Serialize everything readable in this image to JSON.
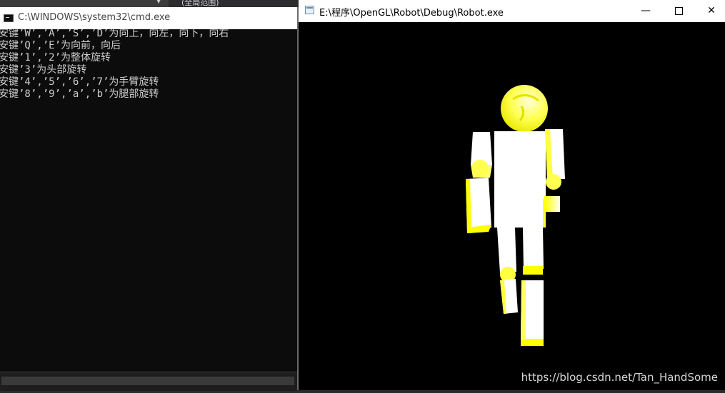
{
  "background_app": {
    "dropdown_icon": "chevron-down-icon",
    "label": "(全局范围)"
  },
  "cmd_window": {
    "title": "C:\\WINDOWS\\system32\\cmd.exe",
    "icon": "console-icon",
    "lines": [
      "安键’W’,’A’,’S’,’D’为向上，向左，向下，向右",
      "安键’Q’,’E’为向前，向后",
      "安键’1’,’2’为整体旋转",
      "安键’3’为头部旋转",
      "安键’4’,’5’,’6’,’7’为手臂旋转",
      "安键’8’,’9’,’a’,’b’为腿部旋转"
    ]
  },
  "robot_window": {
    "title": "E:\\程序\\OpenGL\\Robot\\Debug\\Robot.exe",
    "icon": "window-app-icon",
    "buttons": {
      "minimize": "minimize-icon",
      "maximize": "maximize-icon",
      "close": "close-icon"
    },
    "colors": {
      "body": "#ffffff",
      "joint": "#ffff00",
      "background": "#000000"
    }
  },
  "watermark": "https://blog.csdn.net/Tan_HandSome"
}
